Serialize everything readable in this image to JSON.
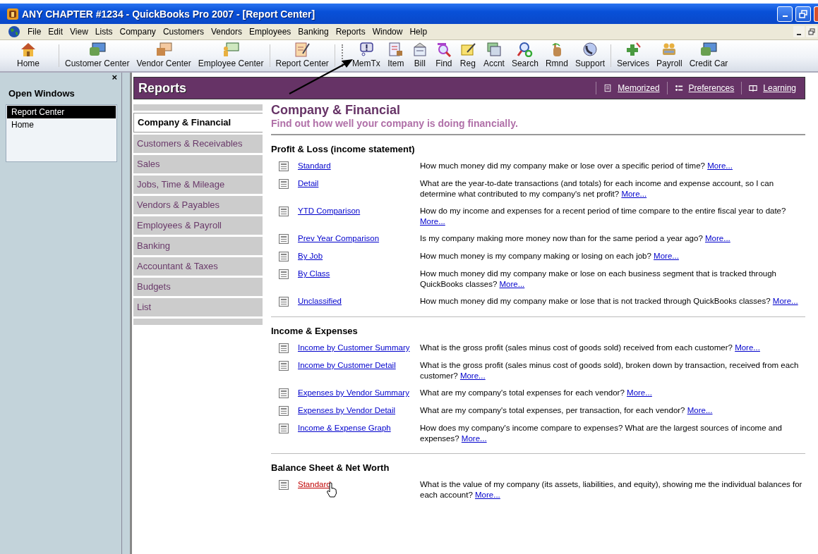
{
  "window": {
    "title": "ANY CHAPTER #1234 - QuickBooks Pro 2007 - [Report Center]"
  },
  "menu": [
    "File",
    "Edit",
    "View",
    "Lists",
    "Company",
    "Customers",
    "Vendors",
    "Employees",
    "Banking",
    "Reports",
    "Window",
    "Help"
  ],
  "toolbar_groups": [
    [
      {
        "label": "Home"
      }
    ],
    [
      {
        "label": "Customer Center"
      },
      {
        "label": "Vendor Center"
      },
      {
        "label": "Employee Center"
      }
    ],
    [
      {
        "label": "Report Center"
      }
    ],
    [
      {
        "label": "MemTx"
      },
      {
        "label": "Item"
      },
      {
        "label": "Bill"
      },
      {
        "label": "Find"
      },
      {
        "label": "Reg"
      },
      {
        "label": "Accnt"
      },
      {
        "label": "Search"
      },
      {
        "label": "Rmnd"
      },
      {
        "label": "Support"
      }
    ],
    [
      {
        "label": "Services"
      },
      {
        "label": "Payroll"
      },
      {
        "label": "Credit Car"
      }
    ]
  ],
  "open_windows": {
    "close": "×",
    "title": "Open Windows",
    "items": [
      {
        "label": "Report Center",
        "selected": true
      },
      {
        "label": "Home",
        "selected": false
      }
    ]
  },
  "reports": {
    "title": "Reports",
    "links": [
      {
        "label": "Memorized"
      },
      {
        "label": "Preferences"
      },
      {
        "label": "Learning"
      }
    ],
    "categories": [
      {
        "label": "Company & Financial",
        "selected": true
      },
      {
        "label": "Customers & Receivables",
        "selected": false
      },
      {
        "label": "Sales",
        "selected": false
      },
      {
        "label": "Jobs, Time & Mileage",
        "selected": false
      },
      {
        "label": "Vendors & Payables",
        "selected": false
      },
      {
        "label": "Employees & Payroll",
        "selected": false
      },
      {
        "label": "Banking",
        "selected": false
      },
      {
        "label": "Accountant & Taxes",
        "selected": false
      },
      {
        "label": "Budgets",
        "selected": false
      },
      {
        "label": "List",
        "selected": false
      }
    ],
    "heading": "Company & Financial",
    "subheading": "Find out how well your company is doing financially.",
    "sections": [
      {
        "title": "Profit & Loss (income statement)",
        "items": [
          {
            "name": "Standard",
            "description": "How much money did my company make or lose over a specific period of time?",
            "more": "More...",
            "hovered": false
          },
          {
            "name": "Detail",
            "description": "What are the year-to-date transactions (and totals) for each income and expense account, so I can determine what contributed to my company's net profit?",
            "more": "More...",
            "hovered": false
          },
          {
            "name": "YTD Comparison",
            "description": "How do my income and expenses for a recent period of time compare to the entire fiscal year to date?",
            "more": "More...",
            "hovered": false
          },
          {
            "name": "Prev Year Comparison",
            "description": "Is my company making more money now than for the same period a year ago?",
            "more": "More...",
            "hovered": false
          },
          {
            "name": "By Job",
            "description": "How much money is my company making or losing on each job?",
            "more": "More...",
            "hovered": false
          },
          {
            "name": "By Class",
            "description": "How much money did my company make or lose on each business segment that is tracked through QuickBooks classes?",
            "more": "More...",
            "hovered": false
          },
          {
            "name": "Unclassified",
            "description": "How much money did my company make or lose that is not tracked through QuickBooks classes?",
            "more": "More...",
            "hovered": false
          }
        ]
      },
      {
        "title": "Income & Expenses",
        "items": [
          {
            "name": "Income by Customer Summary",
            "description": "What is the gross profit (sales minus cost of goods sold) received from each customer?",
            "more": "More...",
            "hovered": false
          },
          {
            "name": "Income by Customer Detail",
            "description": "What is the gross profit (sales minus cost of goods sold), broken down by transaction, received from each customer?",
            "more": "More...",
            "hovered": false
          },
          {
            "name": "Expenses by Vendor Summary",
            "description": "What are my company's total expenses for each vendor?",
            "more": "More...",
            "hovered": false
          },
          {
            "name": "Expenses by Vendor Detail",
            "description": "What are my company's total expenses, per transaction, for each vendor?",
            "more": "More...",
            "hovered": false
          },
          {
            "name": "Income & Expense Graph",
            "description": "How does my company's income compare to expenses? What are the largest sources of income and expenses?",
            "more": "More...",
            "hovered": false
          }
        ]
      },
      {
        "title": "Balance Sheet & Net Worth",
        "items": [
          {
            "name": "Standard",
            "description": "What is the value of my company (its assets, liabilities, and equity), showing me the individual balances for each account?",
            "more": "More...",
            "hovered": true
          }
        ]
      }
    ]
  }
}
